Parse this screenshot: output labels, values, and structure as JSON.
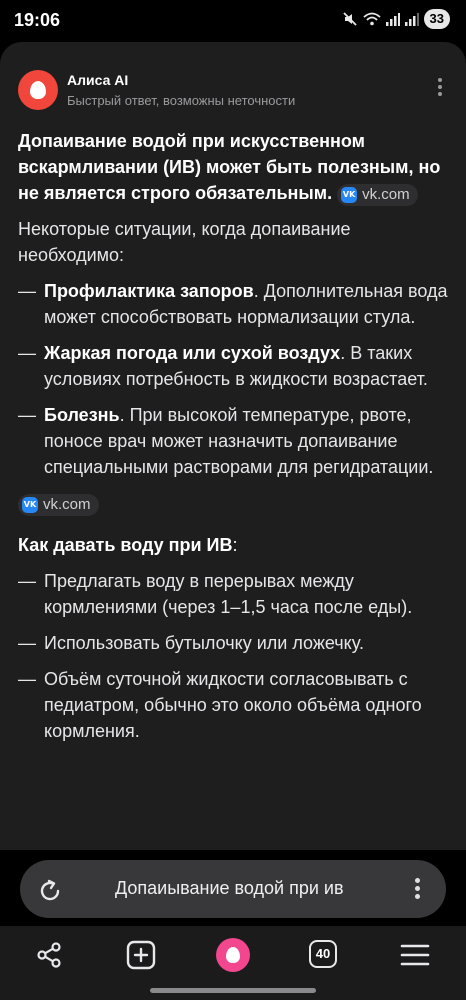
{
  "status_bar": {
    "time": "19:06",
    "battery": "33"
  },
  "assistant": {
    "name": "Алиса AI",
    "subtitle": "Быстрый ответ, возможны неточности"
  },
  "answer": {
    "lead": "Допаивание водой при искусственном вскармливании (ИВ) может быть полезным, но не является строго обязательным.",
    "lead_source": "vk.com",
    "intro": "Некоторые ситуации, когда допаивание необходимо:",
    "situations": [
      {
        "bold": "Профилактика запоров",
        "text": ". Дополнительная вода может способствовать нормализации стула."
      },
      {
        "bold": "Жаркая погода или сухой воздух",
        "text": ". В таких условиях потребность в жидкости возрастает."
      },
      {
        "bold": "Болезнь",
        "text": ". При высокой температуре, рвоте, поносе врач может назначить допаивание специальными растворами для регидратации."
      }
    ],
    "situations_source": "vk.com",
    "how_heading": "Как давать воду при ИВ",
    "how_heading_colon": ":",
    "how_items": [
      "Предлагать воду в перерывах между кормлениями (через 1–1,5 часа после еды).",
      "Использовать бутылочку или ложечку.",
      "Объём суточной жидкости согласовывать с педиатром, обычно это около объёма одного кормления."
    ]
  },
  "input_bar": {
    "query": "Допаиывание водой при ив"
  },
  "nav": {
    "tabs_count": "40"
  },
  "colors": {
    "background": "#1e1e1f",
    "alice_header": "#f0463c",
    "alice_nav": "#f2478f",
    "vk_blue": "#2787f5"
  }
}
